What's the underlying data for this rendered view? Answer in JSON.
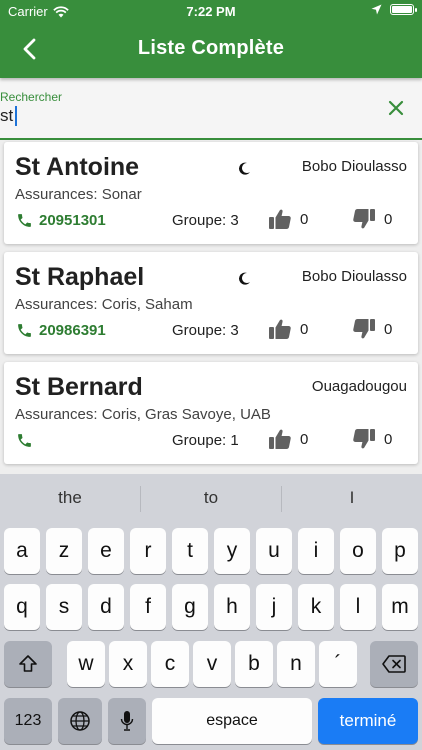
{
  "status": {
    "carrier": "Carrier",
    "time": "7:22 PM"
  },
  "appbar": {
    "title": "Liste Complète"
  },
  "search": {
    "label": "Rechercher",
    "value": "st"
  },
  "results": [
    {
      "name": "St Antoine",
      "city": "Bobo Dioulasso",
      "assurances": "Assurances: Sonar",
      "phone": "20951301",
      "groupe": "Groupe: 3",
      "likes": "0",
      "dislikes": "0"
    },
    {
      "name": "St Raphael",
      "city": "Bobo Dioulasso",
      "assurances": "Assurances: Coris, Saham",
      "phone": "20986391",
      "groupe": "Groupe: 3",
      "likes": "0",
      "dislikes": "0"
    },
    {
      "name": "St Bernard",
      "city": "Ouagadougou",
      "assurances": "Assurances: Coris, Gras Savoye, UAB",
      "phone": "",
      "groupe": "Groupe: 1",
      "likes": "0",
      "dislikes": "0"
    }
  ],
  "keyboard": {
    "suggestions": [
      "the",
      "to",
      "I"
    ],
    "row1": [
      "a",
      "z",
      "e",
      "r",
      "t",
      "y",
      "u",
      "i",
      "o",
      "p"
    ],
    "row2": [
      "q",
      "s",
      "d",
      "f",
      "g",
      "h",
      "j",
      "k",
      "l",
      "m"
    ],
    "row3": [
      "w",
      "x",
      "c",
      "v",
      "b",
      "n",
      "´"
    ],
    "numbers_label": "123",
    "space_label": "espace",
    "done_label": "terminé"
  },
  "colors": {
    "primary": "#388e3c",
    "phone": "#2e7d32",
    "icon_gray": "#616161"
  }
}
